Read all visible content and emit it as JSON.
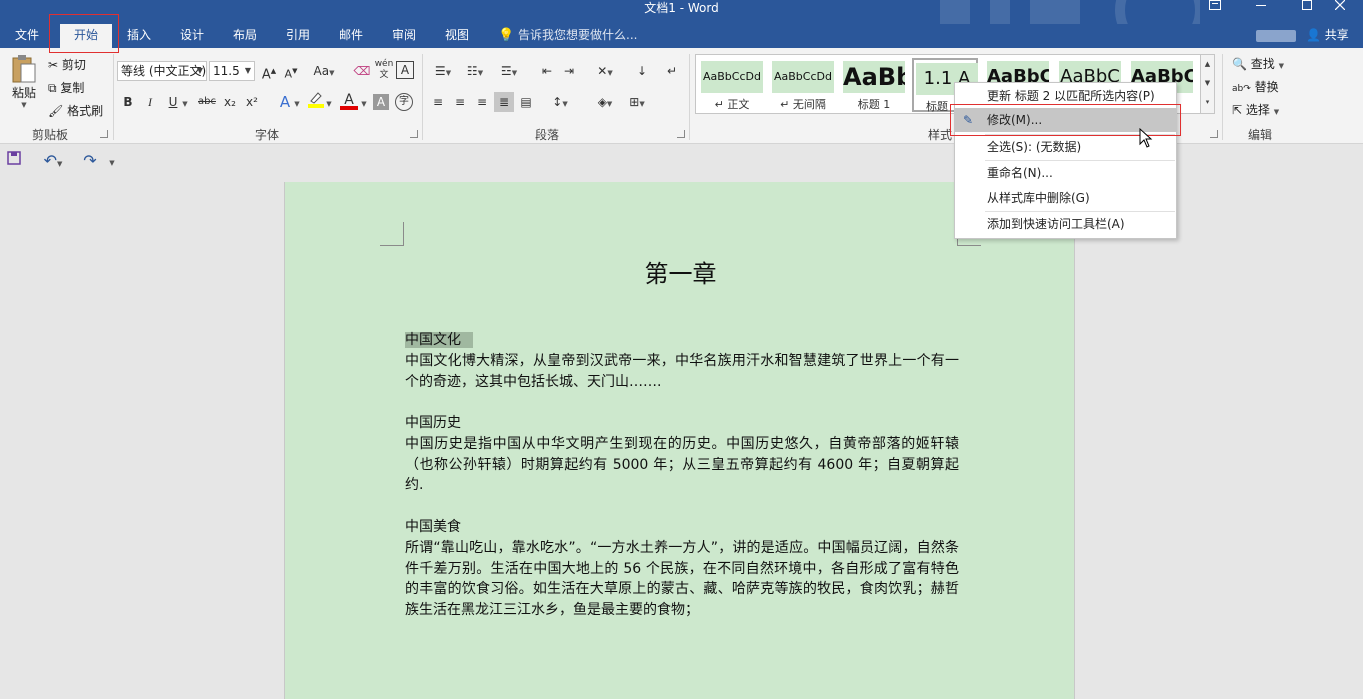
{
  "window": {
    "title": "文档1 - Word",
    "controls": [
      "restore-ribbon",
      "minimize",
      "maximize",
      "close"
    ]
  },
  "tabs": [
    {
      "id": "file",
      "label": "文件"
    },
    {
      "id": "home",
      "label": "开始",
      "active": true
    },
    {
      "id": "insert",
      "label": "插入"
    },
    {
      "id": "design",
      "label": "设计"
    },
    {
      "id": "layout",
      "label": "布局"
    },
    {
      "id": "references",
      "label": "引用"
    },
    {
      "id": "mailings",
      "label": "邮件"
    },
    {
      "id": "review",
      "label": "审阅"
    },
    {
      "id": "view",
      "label": "视图"
    }
  ],
  "tellme": "告诉我您想要做什么...",
  "share": "共享",
  "clipboard": {
    "paste": "粘贴",
    "cut": "剪切",
    "copy": "复制",
    "format_painter": "格式刷",
    "label": "剪贴板"
  },
  "font": {
    "name": "等线 (中文正文)",
    "size": "11.5",
    "label": "字体",
    "case_label": "Aa",
    "bold": "B",
    "italic": "I",
    "underline": "U",
    "strike": "abc",
    "sub": "x₂",
    "sup": "x²",
    "phonetic": "wén",
    "char_shade": "A",
    "enclose": "字",
    "grow": "A",
    "shrink": "A",
    "boxA": "A",
    "effectA": "A",
    "colorA": "A",
    "highlight_color": "#ffff00",
    "font_color": "#e00000"
  },
  "paragraph": {
    "label": "段落"
  },
  "styles": {
    "label": "样式",
    "items": [
      {
        "sample": "AaBbCcDd",
        "name": "正文",
        "prefix": "↵",
        "size": 12
      },
      {
        "sample": "AaBbCcDd",
        "name": "无间隔",
        "prefix": "↵",
        "size": 12
      },
      {
        "sample": "AaBb",
        "name": "标题 1",
        "prefix": "",
        "size": 24
      },
      {
        "sample": "1.1 A",
        "name": "标题",
        "prefix": "",
        "size": 18
      },
      {
        "sample": "AaBbC",
        "name": "",
        "prefix": "",
        "size": 18
      },
      {
        "sample": "AaBbC",
        "name": "",
        "prefix": "",
        "size": 18
      },
      {
        "sample": "AaBbC",
        "name": "",
        "prefix": "",
        "size": 18
      }
    ]
  },
  "editing": {
    "label": "编辑",
    "find": "查找",
    "replace": "替换",
    "select": "选择"
  },
  "context_menu": {
    "items": [
      {
        "label": "更新 标题 2 以匹配所选内容(P)"
      },
      {
        "label": "修改(M)...",
        "hover": true
      },
      {
        "label": "全选(S): (无数据)"
      },
      {
        "label": "重命名(N)..."
      },
      {
        "label": "从样式库中删除(G)"
      },
      {
        "label": "添加到快速访问工具栏(A)"
      }
    ]
  },
  "document": {
    "title": "第一章",
    "sections": [
      {
        "heading": "中国文化",
        "body": "中国文化博大精深，从皇帝到汉武帝一来，中华名族用汗水和智慧建筑了世界上一个有一个的奇迹，这其中包括长城、天门山……."
      },
      {
        "heading": "中国历史",
        "body": "中国历史是指中国从中华文明产生到现在的历史。中国历史悠久，自黄帝部落的姬轩辕（也称公孙轩辕）时期算起约有 5000 年；从三皇五帝算起约有 4600 年；自夏朝算起约."
      },
      {
        "heading": "中国美食",
        "body": "所谓“靠山吃山，靠水吃水”。“一方水土养一方人”，讲的是适应。中国幅员辽阔，自然条件千差万别。生活在中国大地上的 56 个民族，在不同自然环境中，各自形成了富有特色的丰富的饮食习俗。如生活在大草原上的蒙古、藏、哈萨克等族的牧民，食肉饮乳；赫哲族生活在黑龙江三江水乡，鱼是最主要的食物；"
      }
    ]
  }
}
